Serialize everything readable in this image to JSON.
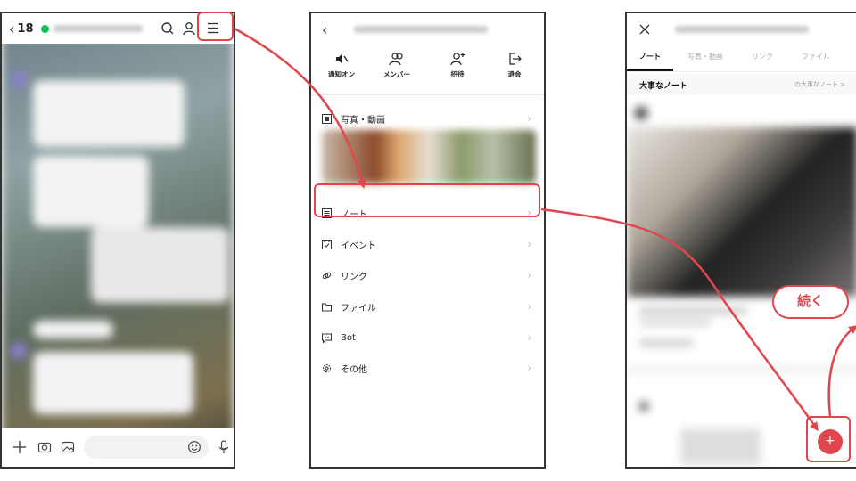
{
  "screen1": {
    "back_count": "18",
    "input_placeholder": ""
  },
  "screen2": {
    "actions": [
      {
        "label": "通知オン",
        "icon": "mute-icon"
      },
      {
        "label": "メンバー",
        "icon": "members-icon"
      },
      {
        "label": "招待",
        "icon": "invite-icon"
      },
      {
        "label": "退会",
        "icon": "leave-icon"
      }
    ],
    "menu": [
      {
        "label": "写真・動画",
        "icon": "photo-icon"
      },
      {
        "label": "ノート",
        "icon": "note-icon"
      },
      {
        "label": "イベント",
        "icon": "calendar-icon"
      },
      {
        "label": "リンク",
        "icon": "link-icon"
      },
      {
        "label": "ファイル",
        "icon": "folder-icon"
      },
      {
        "label": "Bot",
        "icon": "bot-icon"
      },
      {
        "label": "その他",
        "icon": "settings-icon"
      }
    ]
  },
  "screen3": {
    "tabs": [
      "ノート",
      "写真・動画",
      "リンク",
      "ファイル"
    ],
    "important_title": "大事なノート",
    "important_link": "の大事なノート >",
    "callout": "続く",
    "fab": "+"
  },
  "colors": {
    "accent": "#e0464c",
    "line_green": "#06c755"
  }
}
